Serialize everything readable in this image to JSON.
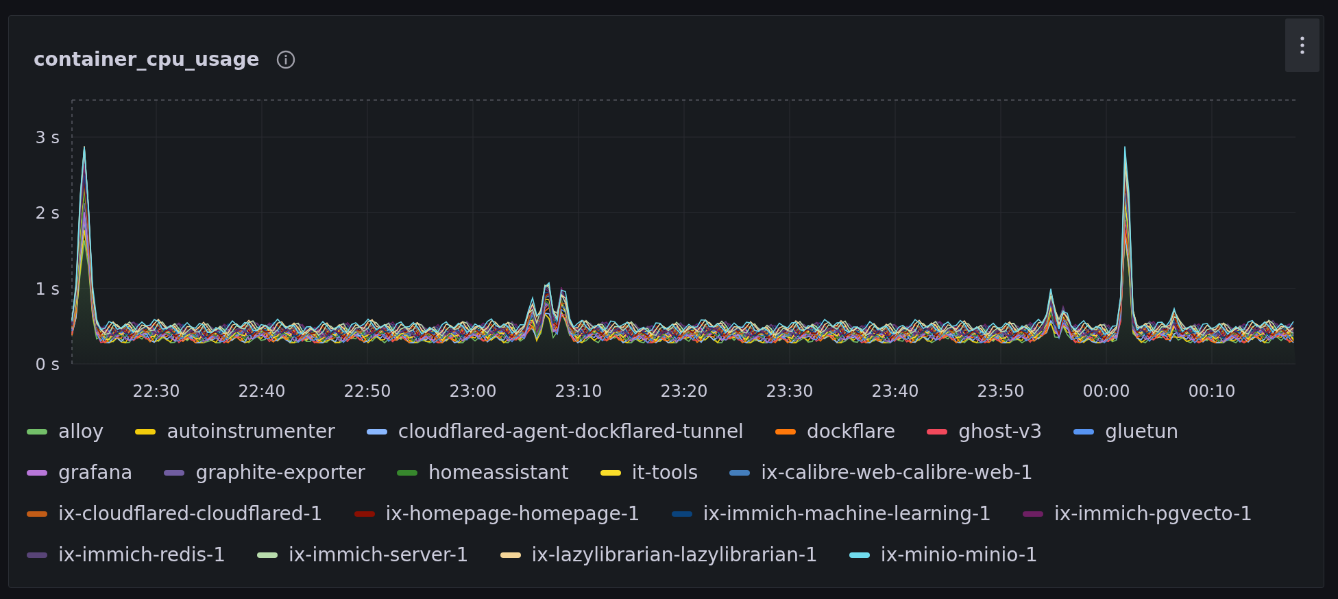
{
  "panel": {
    "title": "container_cpu_usage",
    "y_axis_labels": [
      "3 s",
      "2 s",
      "1 s",
      "0 s"
    ],
    "x_axis_labels": [
      "22:30",
      "22:40",
      "22:50",
      "23:00",
      "23:10",
      "23:20",
      "23:30",
      "23:40",
      "23:50",
      "00:00",
      "00:10"
    ],
    "legend": [
      {
        "name": "alloy",
        "color": "#73bf69"
      },
      {
        "name": "autoinstrumenter",
        "color": "#f2cc0c"
      },
      {
        "name": "cloudflared-agent-dockflared-tunnel",
        "color": "#8ab8ff"
      },
      {
        "name": "dockflare",
        "color": "#ff780a"
      },
      {
        "name": "ghost-v3",
        "color": "#f2495c"
      },
      {
        "name": "gluetun",
        "color": "#5794f2"
      },
      {
        "name": "grafana",
        "color": "#b877d9"
      },
      {
        "name": "graphite-exporter",
        "color": "#705da0"
      },
      {
        "name": "homeassistant",
        "color": "#37872d"
      },
      {
        "name": "it-tools",
        "color": "#fade2a"
      },
      {
        "name": "ix-calibre-web-calibre-web-1",
        "color": "#447ebc"
      },
      {
        "name": "ix-cloudflared-cloudflared-1",
        "color": "#c15c17"
      },
      {
        "name": "ix-homepage-homepage-1",
        "color": "#890f02"
      },
      {
        "name": "ix-immich-machine-learning-1",
        "color": "#0a437c"
      },
      {
        "name": "ix-immich-pgvecto-1",
        "color": "#6d1f62"
      },
      {
        "name": "ix-immich-redis-1",
        "color": "#584477"
      },
      {
        "name": "ix-immich-server-1",
        "color": "#b7dbab"
      },
      {
        "name": "ix-lazylibrarian-lazylibrarian-1",
        "color": "#f4d598"
      },
      {
        "name": "ix-minio-minio-1",
        "color": "#70dbed"
      }
    ]
  }
}
